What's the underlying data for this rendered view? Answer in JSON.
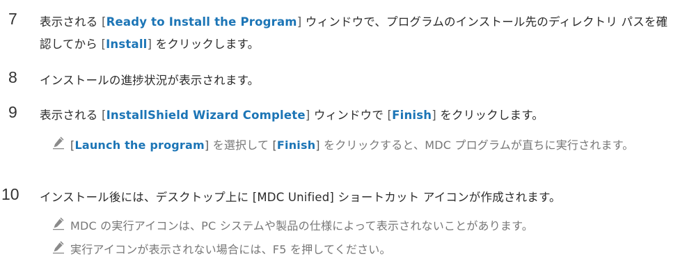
{
  "steps": [
    {
      "number": "7",
      "parts": [
        {
          "t": "表示される "
        },
        {
          "t": "["
        },
        {
          "t": "Ready to Install the Program",
          "hl": true
        },
        {
          "t": "]"
        },
        {
          "t": " ウィンドウで、プログラムのインストール先のディレクトリ パスを確認してから "
        },
        {
          "t": "["
        },
        {
          "t": "Install",
          "hl": true
        },
        {
          "t": "]"
        },
        {
          "t": " をクリックします。"
        }
      ]
    },
    {
      "number": "8",
      "parts": [
        {
          "t": "インストールの進捗状況が表示されます。"
        }
      ]
    },
    {
      "number": "9",
      "parts": [
        {
          "t": "表示される "
        },
        {
          "t": "["
        },
        {
          "t": "InstallShield Wizard Complete",
          "hl": true
        },
        {
          "t": "]"
        },
        {
          "t": " ウィンドウで "
        },
        {
          "t": "["
        },
        {
          "t": "Finish",
          "hl": true
        },
        {
          "t": "]"
        },
        {
          "t": " をクリックします。"
        }
      ]
    },
    {
      "number": "10",
      "parts": [
        {
          "t": "インストール後には、デスクトップ上に [MDC Unified] ショートカット アイコンが作成されます。"
        }
      ]
    }
  ],
  "notes": [
    {
      "icon": "pencil-note-icon",
      "parts": [
        {
          "t": "["
        },
        {
          "t": "Launch the program",
          "hl": true
        },
        {
          "t": "]"
        },
        {
          "t": " を選択して "
        },
        {
          "t": "["
        },
        {
          "t": "Finish",
          "hl": true
        },
        {
          "t": "]"
        },
        {
          "t": " をクリックすると、MDC プログラムが直ちに実行されます。"
        }
      ]
    },
    {
      "icon": "pencil-note-icon",
      "parts": [
        {
          "t": "MDC の実行アイコンは、PC システムや製品の仕様によって表示されないことがあります。"
        }
      ]
    },
    {
      "icon": "pencil-note-icon",
      "parts": [
        {
          "t": "実行アイコンが表示されない場合には、F5 を押してください。"
        }
      ]
    }
  ],
  "colors": {
    "text": "#2b2b2b",
    "highlight": "#1c75b6",
    "note_text": "#777777",
    "icon": "#8a8a8a"
  }
}
